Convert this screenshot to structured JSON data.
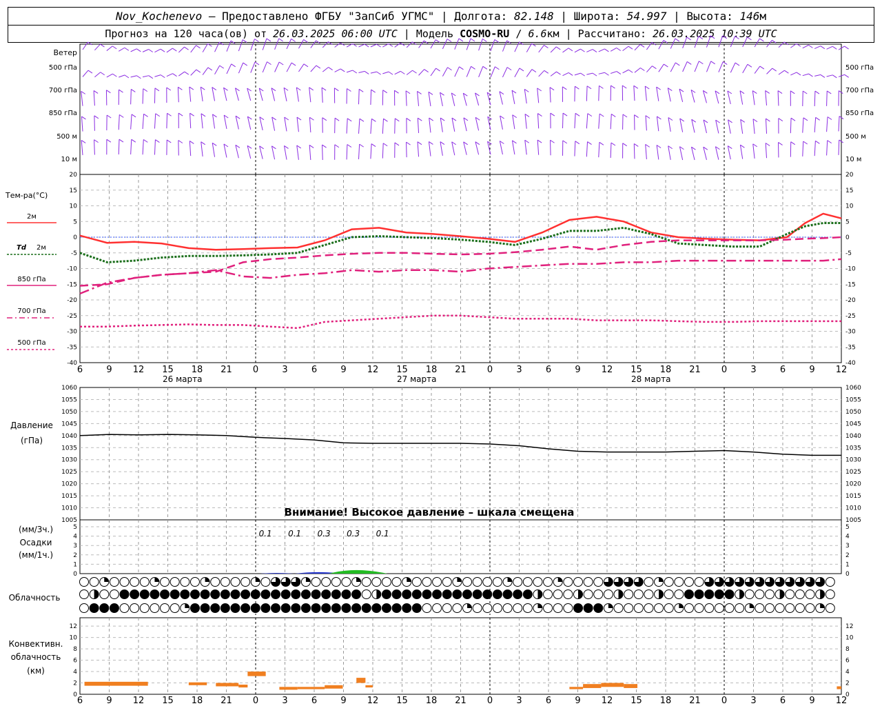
{
  "header": {
    "station": "Nov_Kochenevo",
    "provider_prefix": " – Предоставлено ФГБУ \"ЗапСиб УГМС\" | Долгота: ",
    "longitude": "82.148",
    "lat_label": " | Широта: ",
    "latitude": "54.997",
    "alt_label": " | Высота: ",
    "altitude": "146",
    "alt_unit": "м",
    "forecast_prefix": "Прогноз на 120 часа(ов) от ",
    "forecast_from": "26.03.2025 06:00 UTC",
    "model_label": " | Модель ",
    "model": "COSMO-RU",
    "model_sep": " / ",
    "resolution": "6.6",
    "res_unit": "км",
    "calc_label": " | Рассчитано: ",
    "calc_time": "26.03.2025 10:39 UTC"
  },
  "wind_panel": {
    "title": "Ветер",
    "levels": [
      "500 гПа",
      "700 гПа",
      "850 гПа",
      "500 м",
      "10 м"
    ],
    "color": "#8a2be2"
  },
  "x_axis": {
    "hour_labels": [
      "6",
      "9",
      "12",
      "15",
      "18",
      "21",
      "0",
      "3",
      "6",
      "9",
      "12",
      "15",
      "18",
      "21",
      "0",
      "3",
      "6",
      "9",
      "12",
      "15",
      "18",
      "21",
      "0",
      "3",
      "6",
      "9",
      "12"
    ],
    "date_labels": [
      "26 марта",
      "27 марта",
      "28 марта"
    ]
  },
  "legend": {
    "title": "Тем-ра(°C)",
    "t2m": "2м",
    "td_label": "Td",
    "td_level": "2м",
    "l850": "850 гПа",
    "l700": "700 гПа",
    "l500": "500 гПа"
  },
  "pressure_panel": {
    "label": "Давление",
    "unit": "(гПа)",
    "warning": "Внимание! Высокое давление – шкала смещена",
    "ticks": [
      "1060",
      "1055",
      "1050",
      "1045",
      "1040",
      "1035",
      "1030",
      "1025",
      "1020",
      "1015",
      "1010",
      "1005"
    ]
  },
  "precip_panel": {
    "unit3h": "(мм/3ч.)",
    "label": "Осадки",
    "unit1h": "(мм/1ч.)",
    "ticks": [
      "5",
      "4",
      "3",
      "2",
      "1",
      "0"
    ],
    "amount_labels": [
      "0.1",
      "0.1",
      "0.3",
      "0.3",
      "0.1"
    ]
  },
  "cloud_panel": {
    "label": "Облачность"
  },
  "conv_panel": {
    "label1": "Конвективн.",
    "label2": "облачность",
    "unit": "(км)",
    "ticks": [
      "12",
      "10",
      "8",
      "6",
      "4",
      "2",
      "0"
    ]
  },
  "colors": {
    "t2m": "#ff3030",
    "td": "#1a6e1a",
    "upper": "#e0207c",
    "pressure": "#000000",
    "precip_green": "#22bb22",
    "precip_blue": "#2233cc",
    "conv": "#f07f20",
    "zero_line": "#3355ff"
  },
  "chart_data": {
    "type": "line",
    "x_hours_from_start": [
      0,
      3,
      6,
      9,
      12,
      15,
      18,
      21,
      24,
      27,
      30,
      33,
      36,
      39,
      42,
      45,
      48,
      51,
      54,
      57,
      60,
      63,
      66,
      69,
      72,
      75,
      78
    ],
    "x_ticks": [
      "6",
      "9",
      "12",
      "15",
      "18",
      "21",
      "0",
      "3",
      "6",
      "9",
      "12",
      "15",
      "18",
      "21",
      "0",
      "3",
      "6",
      "9",
      "12",
      "15",
      "18",
      "21",
      "0",
      "3",
      "6",
      "9",
      "12"
    ],
    "temperature": {
      "ylabel": "Тем-ра(°C)",
      "ylim": [
        -40,
        20
      ],
      "series": [
        {
          "name": "2м",
          "values": [
            0.5,
            -1.8,
            -1.5,
            -2,
            -3.5,
            -4,
            -3.8,
            -3.5,
            -3.3,
            -1,
            2.5,
            3,
            1.5,
            1,
            0.3,
            -0.5,
            -1.5,
            1.5,
            5.5,
            6.5,
            5,
            1.5,
            0,
            -0.5,
            -0.8,
            -1,
            0,
            4.5,
            7.5,
            6
          ]
        },
        {
          "name": "Td 2м",
          "values": [
            -5,
            -8,
            -7.5,
            -6.5,
            -6,
            -6,
            -5.8,
            -5.5,
            -5,
            -2.5,
            0,
            0.3,
            0,
            -0.3,
            -0.8,
            -1.5,
            -2.5,
            -0.5,
            2,
            2,
            3,
            1,
            -2,
            -2.5,
            -3,
            -3,
            1,
            3.5,
            4.5,
            4.5
          ]
        },
        {
          "name": "850 гПа",
          "values": [
            -15.5,
            -15,
            -13,
            -12,
            -11.5,
            -11,
            -8,
            -7,
            -6.5,
            -5.8,
            -5.3,
            -5,
            -5,
            -5.3,
            -5.5,
            -5.3,
            -4.8,
            -4,
            -3,
            -4,
            -2.5,
            -1.5,
            -1,
            -1,
            -1,
            -1,
            -0.8,
            -0.5,
            -0.3,
            0
          ]
        },
        {
          "name": "700 гПа",
          "values": [
            -18,
            -14.5,
            -13,
            -12,
            -11.5,
            -10.5,
            -12.5,
            -13,
            -12,
            -11.5,
            -10.5,
            -11,
            -10.5,
            -10.5,
            -11,
            -10,
            -9.5,
            -9,
            -8.5,
            -8.5,
            -8,
            -8,
            -7.5,
            -7.5,
            -7.5,
            -7.5,
            -7.5,
            -7.5,
            -7.5,
            -7
          ]
        },
        {
          "name": "500 гПа",
          "values": [
            -28.5,
            -28.5,
            -28.2,
            -28,
            -27.8,
            -28,
            -28,
            -28.5,
            -29,
            -27,
            -26.5,
            -26,
            -25.5,
            -25,
            -25,
            -25.5,
            -26,
            -26,
            -26,
            -26.5,
            -26.5,
            -26.5,
            -26.8,
            -27,
            -27,
            -26.8,
            -26.8,
            -26.8,
            -26.8,
            -26.8
          ]
        }
      ],
      "series_x_hours": [
        0,
        3,
        6,
        9,
        12,
        15,
        18,
        21,
        24,
        27,
        30,
        33,
        36,
        39,
        42,
        45,
        48,
        51,
        54,
        57,
        60,
        63,
        66,
        69,
        72,
        75,
        78,
        80,
        82,
        84
      ]
    },
    "pressure": {
      "ylabel": "Давление (гПа)",
      "ylim": [
        1005,
        1060
      ],
      "values": [
        1040,
        1040.5,
        1040.3,
        1040.5,
        1040.3,
        1040,
        1039.3,
        1038.8,
        1038.2,
        1037,
        1036.8,
        1036.8,
        1036.8,
        1036.8,
        1036.5,
        1035.8,
        1034.5,
        1033.5,
        1033.2,
        1033.2,
        1033.2,
        1033.5,
        1033.8,
        1033.2,
        1032.3,
        1031.8,
        1031.8
      ],
      "x_hours": [
        0,
        3,
        6,
        9,
        12,
        15,
        18,
        21,
        24,
        27,
        30,
        33,
        36,
        39,
        42,
        45,
        48,
        51,
        54,
        57,
        60,
        63,
        66,
        69,
        72,
        75,
        78
      ]
    },
    "precipitation": {
      "ylabel": "Осадки (мм/1ч.)",
      "ylim": [
        0,
        5
      ],
      "amounts_3h": [
        "0.1",
        "0.1",
        "0.3",
        "0.3",
        "0.1"
      ],
      "amounts_x_hours": [
        19,
        22,
        25,
        28,
        31
      ]
    },
    "convective_cloud": {
      "ylabel": "Конвективн. облачность (км)",
      "ylim": [
        0,
        12
      ],
      "segments": [
        {
          "x0": 0.5,
          "x1": 7.5,
          "base": 1.5,
          "top": 2.2
        },
        {
          "x0": 12,
          "x1": 14,
          "base": 1.6,
          "top": 2.1
        },
        {
          "x0": 15,
          "x1": 17.5,
          "base": 1.4,
          "top": 2.0
        },
        {
          "x0": 17.5,
          "x1": 18.5,
          "base": 1.2,
          "top": 1.7
        },
        {
          "x0": 18.5,
          "x1": 20.5,
          "base": 3.2,
          "top": 4.0
        },
        {
          "x0": 22,
          "x1": 24,
          "base": 0.8,
          "top": 1.3
        },
        {
          "x0": 24,
          "x1": 27,
          "base": 0.9,
          "top": 1.3
        },
        {
          "x0": 27,
          "x1": 29,
          "base": 1.0,
          "top": 1.6
        },
        {
          "x0": 30.5,
          "x1": 31.5,
          "base": 2.0,
          "top": 2.9
        },
        {
          "x0": 31.5,
          "x1": 32.3,
          "base": 1.2,
          "top": 1.6
        },
        {
          "x0": 54,
          "x1": 55.5,
          "base": 0.9,
          "top": 1.3
        },
        {
          "x0": 55.5,
          "x1": 57.5,
          "base": 1.1,
          "top": 1.8
        },
        {
          "x0": 57.5,
          "x1": 60,
          "base": 1.3,
          "top": 2.0
        },
        {
          "x0": 60,
          "x1": 61.5,
          "base": 1.1,
          "top": 1.8
        },
        {
          "x0": 83.5,
          "x1": 84,
          "base": 0.9,
          "top": 1.4
        }
      ]
    }
  }
}
